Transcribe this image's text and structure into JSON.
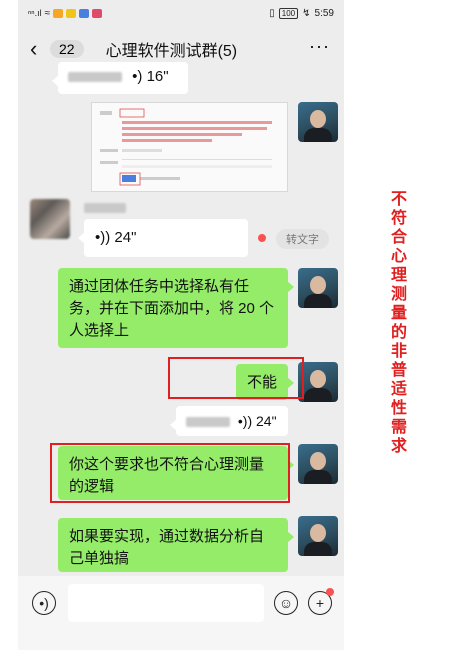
{
  "status_bar": {
    "signal": "⁴⁴.ııl",
    "battery": "100",
    "time": "5:59"
  },
  "header": {
    "back_icon": "‹",
    "unread_count": "22",
    "title": "心理软件测试群(5)",
    "more_icon": "···"
  },
  "messages": {
    "voice_top_duration": "16\"",
    "voice_incoming_duration": "24\"",
    "convert_label": "转文字",
    "msg1": "通过团体任务中选择私有任务，并在下面添加中，将 20 个人选择上",
    "msg2": "不能",
    "voice_mid_duration": "24\"",
    "msg3": "你这个要求也不符合心理测量的逻辑",
    "msg4": "如果要实现，通过数据分析自己单独搞"
  },
  "annotation": "不符合心理测量的非普适性需求",
  "colors": {
    "accent_red": "#e02020",
    "bubble_green": "#95ec69",
    "background": "#ededed"
  }
}
